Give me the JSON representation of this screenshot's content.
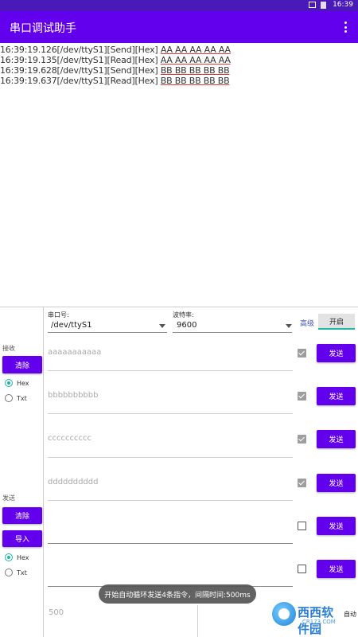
{
  "status_bar": {
    "time": "16:39"
  },
  "app_bar": {
    "title": "串口调试助手",
    "menu_icon": "more-vert-icon"
  },
  "log": [
    {
      "time": "16:39:19.126",
      "port": "[/dev/ttyS1]",
      "dir": "[Send]",
      "fmt": "[Hex]",
      "data": "AA AA AA AA AA"
    },
    {
      "time": "16:39:19.135",
      "port": "[/dev/ttyS1]",
      "dir": "[Read]",
      "fmt": "[Hex]",
      "data": "AA AA AA AA AA"
    },
    {
      "time": "16:39:19.628",
      "port": "[/dev/ttyS1]",
      "dir": "[Send]",
      "fmt": "[Hex]",
      "data": "BB BB BB BB BB"
    },
    {
      "time": "16:39:19.637",
      "port": "[/dev/ttyS1]",
      "dir": "[Read]",
      "fmt": "[Hex]",
      "data": "BB BB BB BB BB"
    }
  ],
  "receive": {
    "label": "接收",
    "clear_label": "清除",
    "hex_label": "Hex",
    "txt_label": "Txt",
    "selected": "Hex"
  },
  "send": {
    "label": "发送",
    "clear_label": "清除",
    "import_label": "导入",
    "hex_label": "Hex",
    "txt_label": "Txt",
    "selected": "Hex"
  },
  "port": {
    "label": "串口号:",
    "value": "/dev/ttyS1"
  },
  "baud": {
    "label": "波特率:",
    "value": "9600"
  },
  "advanced_label": "高级",
  "open_label": "开启",
  "commands": [
    {
      "placeholder": "aaaaaaaaaaa",
      "checked": true,
      "send_label": "发送"
    },
    {
      "placeholder": "bbbbbbbbbb",
      "checked": true,
      "send_label": "发送"
    },
    {
      "placeholder": "cccccccccc",
      "checked": true,
      "send_label": "发送"
    },
    {
      "placeholder": "dddddddddd",
      "checked": true,
      "send_label": "发送"
    },
    {
      "placeholder": "",
      "checked": false,
      "send_label": "发送"
    },
    {
      "placeholder": "",
      "checked": false,
      "send_label": "发送"
    }
  ],
  "toast": "开始自动循环发送4条指令，间隔时间:500ms",
  "interval_placeholder": "500",
  "auto_label": "自动",
  "watermark": {
    "title": "西西软件园",
    "sub": "CR173.COM"
  },
  "colors": {
    "primary": "#6200ee",
    "status": "#4a1ab8",
    "accent": "#1cb6a6"
  }
}
